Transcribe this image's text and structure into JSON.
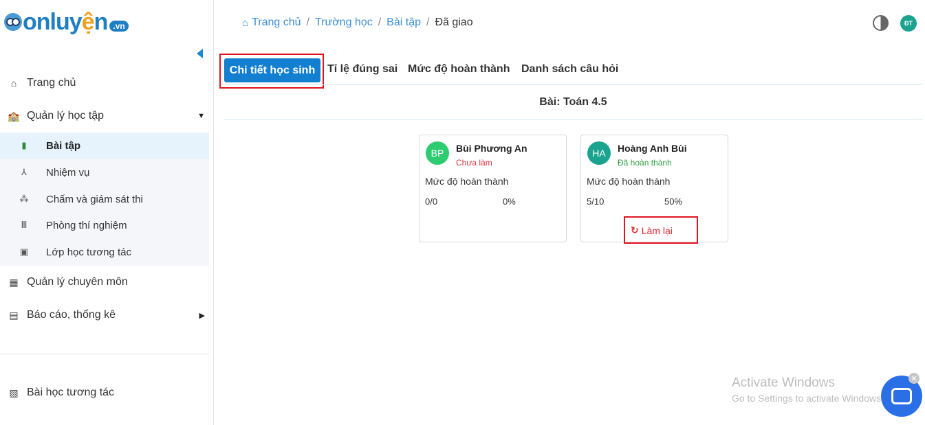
{
  "logo": {
    "brand_prefix": "on",
    "brand_mid": "luy",
    "brand_y": "ệ",
    "brand_suffix": "n",
    "tld": ".vn"
  },
  "sidebar": {
    "items": [
      {
        "label": "Trang chủ",
        "icon": "home-icon"
      },
      {
        "label": "Quản lý học tập",
        "icon": "school-icon"
      },
      {
        "label": "Quản lý chuyên môn",
        "icon": "calendar-icon"
      },
      {
        "label": "Báo cáo, thống kê",
        "icon": "report-icon"
      }
    ],
    "sub_items": [
      {
        "label": "Bài tập",
        "icon": "exercise-icon"
      },
      {
        "label": "Nhiệm vụ",
        "icon": "task-icon"
      },
      {
        "label": "Chấm và giám sát thi",
        "icon": "exam-icon"
      },
      {
        "label": "Phòng thí nghiệm",
        "icon": "lab-icon"
      },
      {
        "label": "Lớp học tương tác",
        "icon": "classroom-icon"
      }
    ],
    "footer_item": {
      "label": "Bài học tương tác",
      "icon": "lesson-icon"
    }
  },
  "breadcrumb": {
    "home": "Trang chủ",
    "school": "Trường học",
    "exercise": "Bài tập",
    "current": "Đã giao"
  },
  "header": {
    "avatar_initials": "ĐT"
  },
  "tabs": [
    "Chi tiết học sinh",
    "Tỉ lệ đúng sai",
    "Mức độ hoàn thành",
    "Danh sách câu hỏi"
  ],
  "assignment_title": "Bài: Toán 4.5",
  "students": [
    {
      "initials": "BP",
      "name": "Bùi Phương An",
      "status": "Chưa làm",
      "status_color": "#e0363f",
      "avatar_color": "#2ecc71",
      "label": "Mức độ hoàn thành",
      "score": "0/0",
      "percent": "0%"
    },
    {
      "initials": "HA",
      "name": "Hoàng Anh Bùi",
      "status": "Đã hoàn thành",
      "status_color": "#2ea043",
      "avatar_color": "#1aa38e",
      "label": "Mức độ hoàn thành",
      "score": "5/10",
      "percent": "50%"
    }
  ],
  "redo_label": "Làm lại",
  "watermark": {
    "line1": "Activate Windows",
    "line2": "Go to Settings to activate Windows."
  }
}
